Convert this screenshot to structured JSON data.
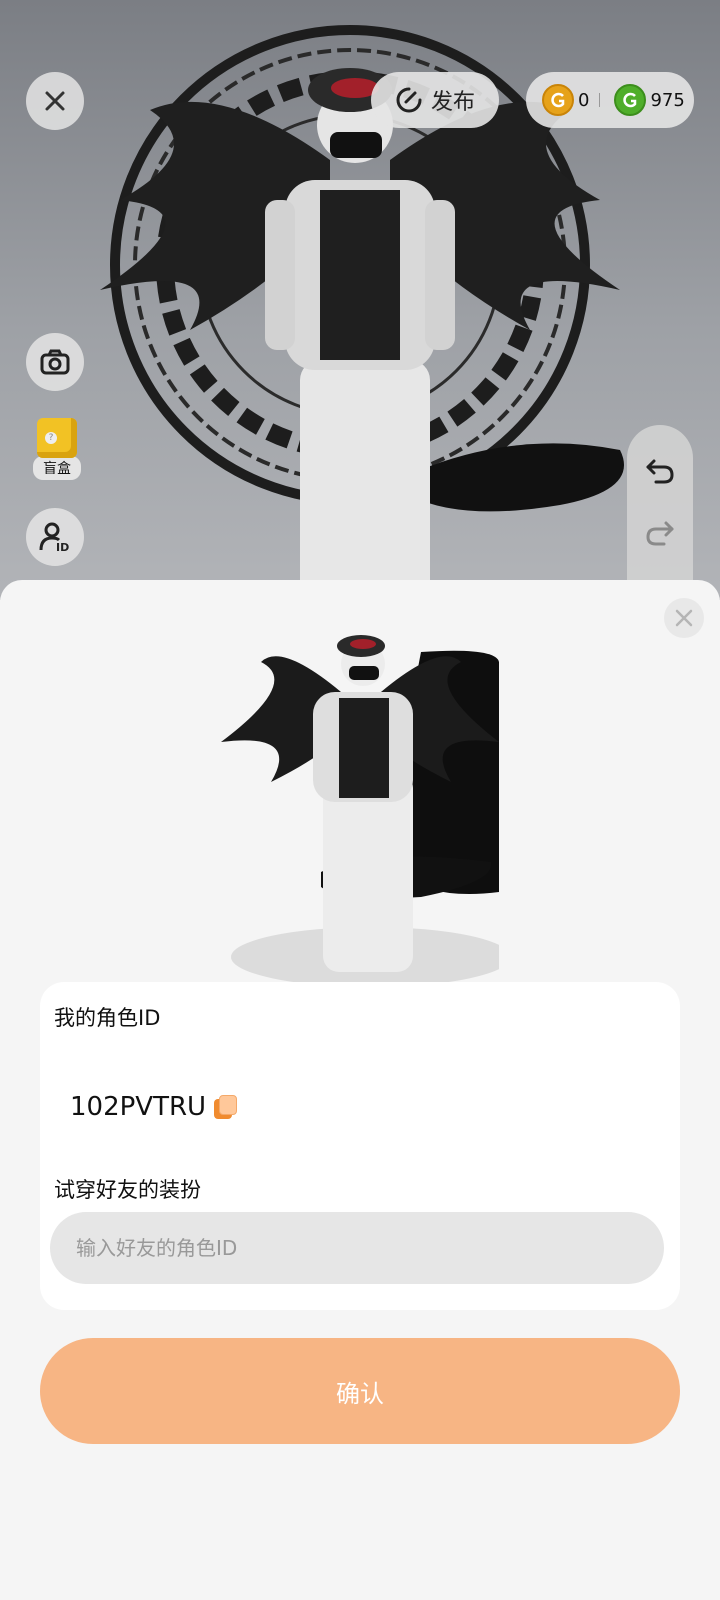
{
  "topbar": {
    "publish_label": "发布",
    "gold_coin_count": "0",
    "green_coin_count": "975"
  },
  "left_tools": {
    "blind_box_label": "盲盒"
  },
  "sheet": {
    "my_id_label": "我的角色ID",
    "my_id_value": "102PVTRU",
    "try_on_label": "试穿好友的装扮",
    "friend_id_placeholder": "输入好友的角色ID",
    "confirm_label": "确认"
  },
  "colors": {
    "accent": "#f7b584",
    "gold_coin": "#e6a21a",
    "green_coin": "#4fae2a"
  }
}
